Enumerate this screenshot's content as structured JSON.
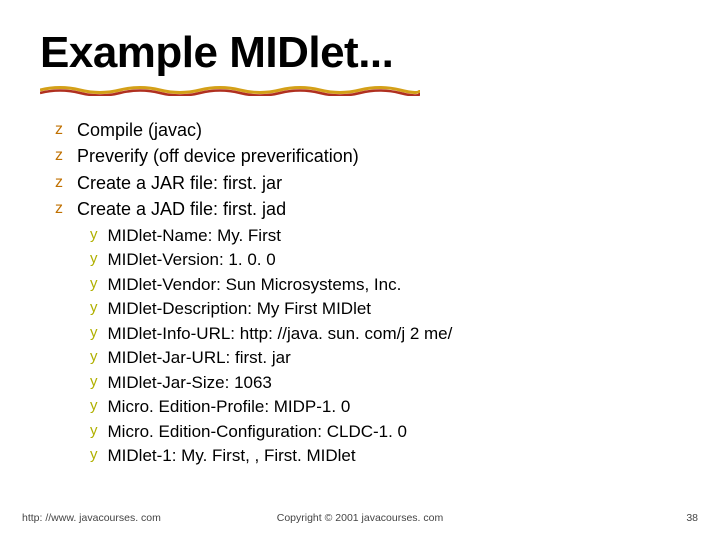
{
  "title": "Example MIDlet...",
  "main_items": [
    "Compile (javac)",
    "Preverify (off device preverification)",
    "Create a JAR file: first. jar",
    "Create  a JAD file: first. jad"
  ],
  "sub_items": [
    "MIDlet-Name: My. First",
    "MIDlet-Version: 1. 0. 0",
    "MIDlet-Vendor: Sun Microsystems, Inc.",
    "MIDlet-Description: My First MIDlet",
    "MIDlet-Info-URL: http: //java. sun. com/j 2 me/",
    "MIDlet-Jar-URL: first. jar",
    "MIDlet-Jar-Size: 1063",
    "Micro. Edition-Profile: MIDP-1. 0",
    "Micro. Edition-Configuration: CLDC-1. 0",
    "MIDlet-1: My. First, , First. MIDlet"
  ],
  "footer": {
    "left": "http: //www. javacourses. com",
    "center": "Copyright © 2001 javacourses. com",
    "right": "38"
  },
  "bullets": {
    "z": "z",
    "y": "y"
  }
}
